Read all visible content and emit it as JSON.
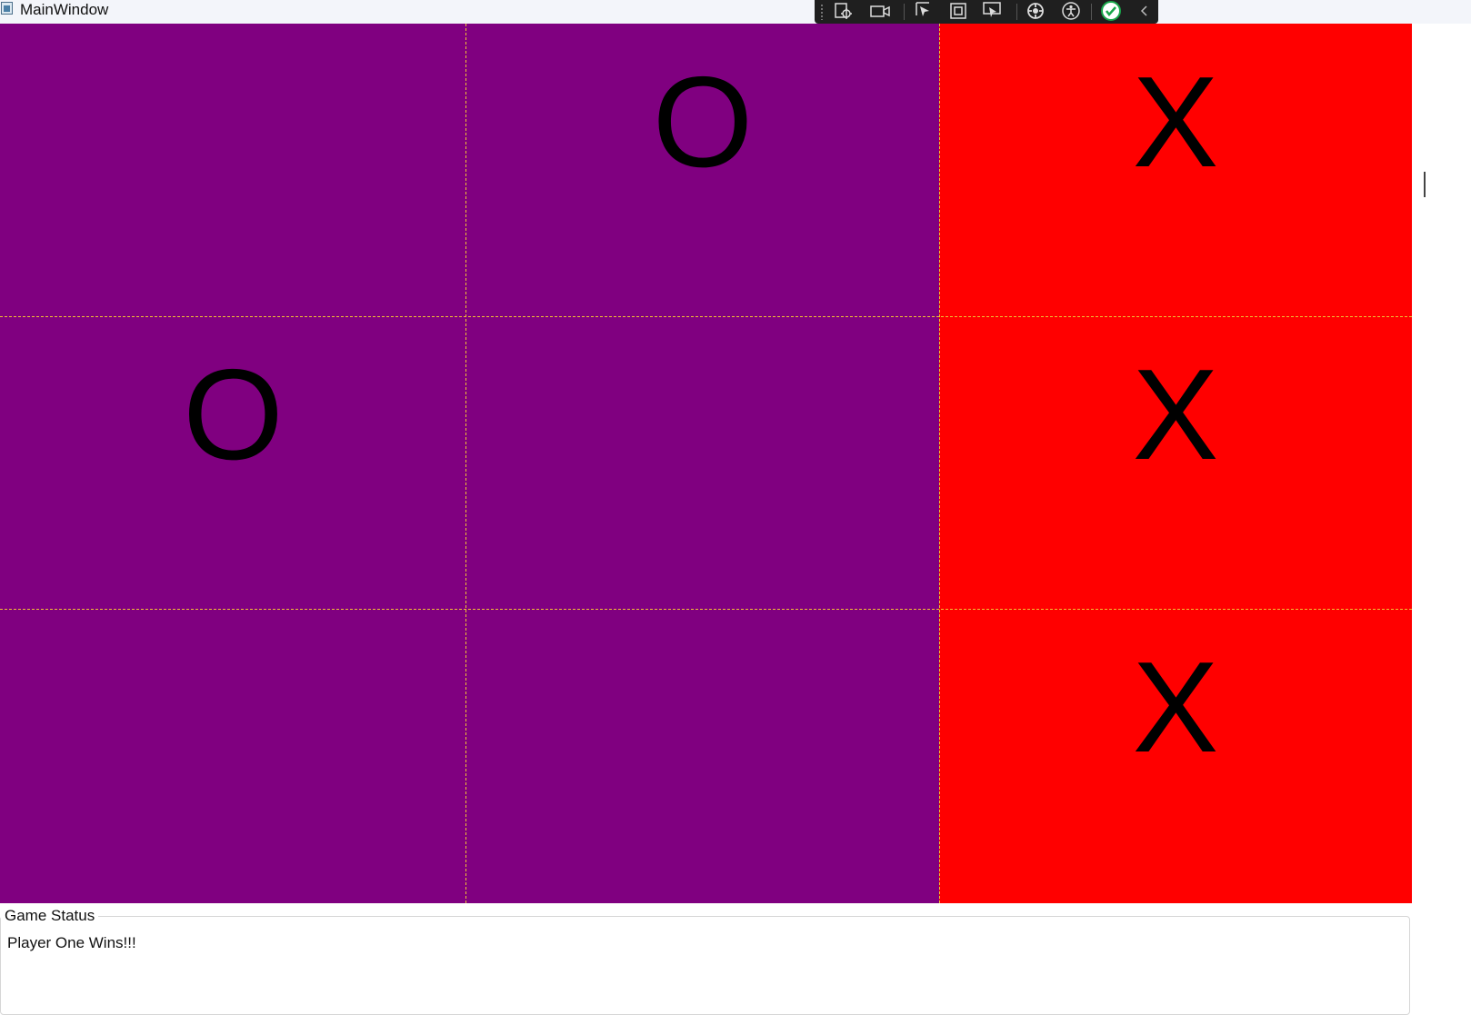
{
  "window": {
    "title": "MainWindow"
  },
  "devtools": {
    "tools": [
      "live-visual-tree-icon",
      "record-icon",
      "select-element-icon",
      "display-layout-adorners-icon",
      "track-focused-element-icon",
      "hot-reload-icon",
      "accessibility-icon",
      "binding-ok-icon",
      "collapse-icon"
    ]
  },
  "board": {
    "cells": [
      {
        "mark": "",
        "color": "#800080"
      },
      {
        "mark": "O",
        "color": "#800080"
      },
      {
        "mark": "X",
        "color": "#ff0000"
      },
      {
        "mark": "O",
        "color": "#800080"
      },
      {
        "mark": "",
        "color": "#800080"
      },
      {
        "mark": "X",
        "color": "#ff0000"
      },
      {
        "mark": "",
        "color": "#800080"
      },
      {
        "mark": "",
        "color": "#800080"
      },
      {
        "mark": "X",
        "color": "#ff0000"
      }
    ],
    "grid_line_color": "#f1c232"
  },
  "status": {
    "label": "Game Status",
    "text": "Player One Wins!!!"
  }
}
